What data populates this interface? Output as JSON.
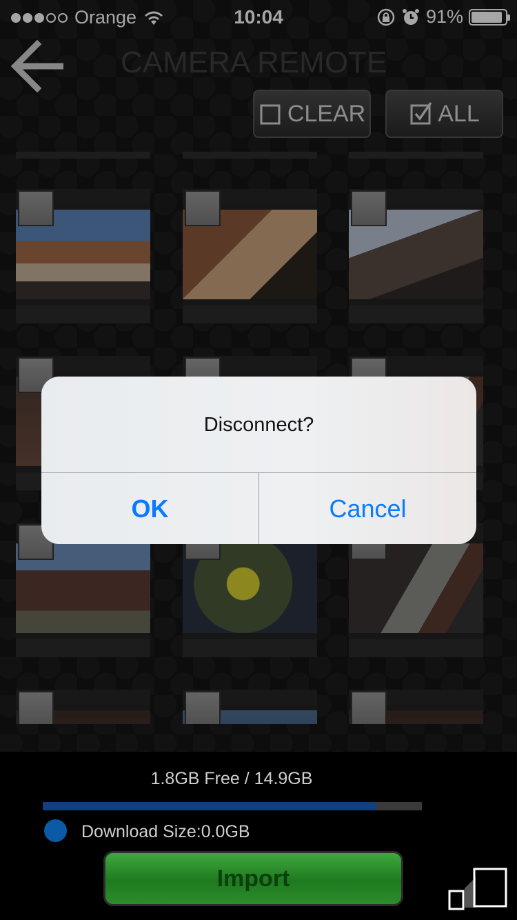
{
  "status_bar": {
    "carrier": "Orange",
    "time": "10:04",
    "battery_percent": "91%",
    "signal_bars": 3,
    "signal_total": 5,
    "battery_level": 0.91
  },
  "header": {
    "title": "CAMERA REMOTE",
    "clear_label": "CLEAR",
    "all_label": "ALL"
  },
  "photos": [
    {
      "checked": false,
      "photo": "ph1"
    },
    {
      "checked": false,
      "photo": "ph2"
    },
    {
      "checked": false,
      "photo": "ph3"
    },
    {
      "checked": false,
      "photo": "ph7"
    },
    {
      "checked": false,
      "photo": "ph8"
    },
    {
      "checked": false,
      "photo": "ph6"
    },
    {
      "checked": false,
      "photo": "ph4"
    },
    {
      "checked": false,
      "photo": "ph5"
    },
    {
      "checked": false,
      "photo": "ph6"
    },
    {
      "checked": false,
      "photo": "ph9"
    },
    {
      "checked": false,
      "photo": "ph8"
    },
    {
      "checked": false,
      "photo": "ph9"
    }
  ],
  "storage": {
    "text": "1.8GB Free / 14.9GB",
    "used_fraction": 0.88
  },
  "download": {
    "text": "Download Size:0.0GB"
  },
  "import_label": "Import",
  "alert": {
    "title": "Disconnect?",
    "ok_label": "OK",
    "cancel_label": "Cancel"
  },
  "colors": {
    "accent": "#0a7aff",
    "import_green": "#2e8f2e",
    "storage_fill": "#123f7e"
  }
}
